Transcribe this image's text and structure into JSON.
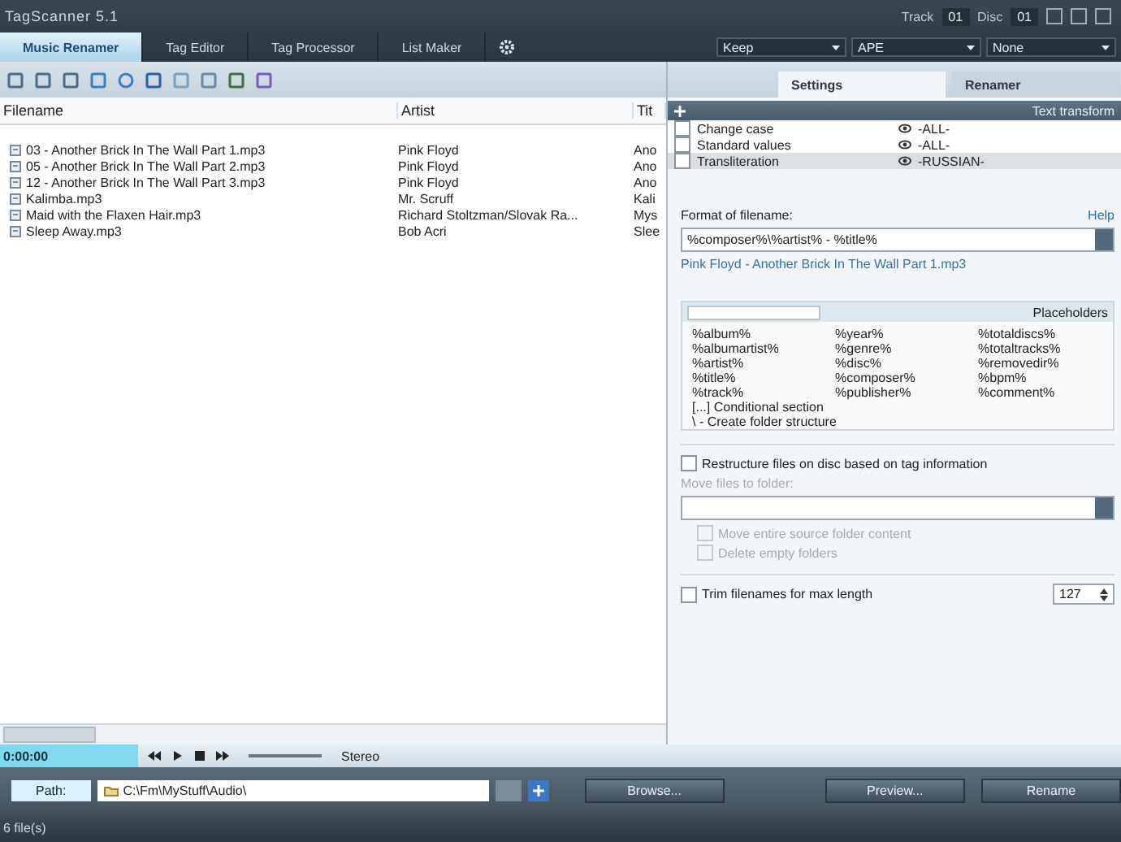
{
  "window": {
    "title": "TagScanner 5.1"
  },
  "tabs": [
    {
      "label": "Music Renamer",
      "selected": true
    },
    {
      "label": "Tag Editor",
      "selected": false
    },
    {
      "label": "Tag Processor",
      "selected": false
    },
    {
      "label": "List Maker",
      "selected": false
    }
  ],
  "top_controls": {
    "track_label": "Track",
    "track_value": "01",
    "disc_label": "Disc",
    "disc_value": "01",
    "dropdowns": [
      "Keep",
      "APE",
      "None"
    ]
  },
  "panel_tabs": [
    {
      "label": "Settings",
      "selected": true
    },
    {
      "label": "Renamer",
      "selected": false
    }
  ],
  "file_list": {
    "columns": [
      "Filename",
      "Artist",
      "Tit"
    ],
    "rows": [
      {
        "filename": "03 - Another Brick In The Wall Part 1.mp3",
        "artist": "Pink Floyd",
        "title": "Ano"
      },
      {
        "filename": "05 - Another Brick In The Wall Part 2.mp3",
        "artist": "Pink Floyd",
        "title": "Ano"
      },
      {
        "filename": "12 - Another Brick In The Wall Part 3.mp3",
        "artist": "Pink Floyd",
        "title": "Ano"
      },
      {
        "filename": "Kalimba.mp3",
        "artist": "Mr. Scruff",
        "title": "Kali"
      },
      {
        "filename": "Maid with the Flaxen Hair.mp3",
        "artist": "Richard Stoltzman/Slovak Ra...",
        "title": "Mys"
      },
      {
        "filename": "Sleep Away.mp3",
        "artist": "Bob Acri",
        "title": "Slee"
      }
    ]
  },
  "transformations": {
    "title": "Text transform",
    "rows": [
      {
        "label": "Change case",
        "value": "-ALL-",
        "checked": false,
        "selected": false
      },
      {
        "label": "Standard values",
        "value": "-ALL-",
        "checked": false,
        "selected": false
      },
      {
        "label": "Transliteration",
        "value": "-RUSSIAN-",
        "checked": false,
        "selected": true
      }
    ]
  },
  "format": {
    "label": "Format of filename:",
    "help": "Help",
    "value": "%composer%\\%artist% - %title%",
    "preview": "Pink Floyd - Another Brick In The Wall Part 1.mp3"
  },
  "placeholders": {
    "title": "Placeholders",
    "items": [
      "%album%",
      "%year%",
      "%totaldiscs%",
      "%albumartist%",
      "%genre%",
      "%totaltracks%",
      "%artist%",
      "%disc%",
      "%removedir%",
      "%title%",
      "%composer%",
      "%bpm%",
      "%track%",
      "%publisher%",
      "%comment%"
    ],
    "notes": [
      "[...] Conditional section",
      "\\ - Create folder structure"
    ]
  },
  "restructure": {
    "label": "Restructure files on disc based on tag information",
    "checked": false,
    "folder_label": "Move files to folder:",
    "options": [
      {
        "label": "Move entire source folder content",
        "checked": false,
        "disabled": true
      },
      {
        "label": "Delete empty folders",
        "checked": false,
        "disabled": true
      }
    ]
  },
  "trim": {
    "label": "Trim filenames for max length",
    "checked": false,
    "value": "127"
  },
  "player": {
    "time": "0:00:00",
    "volume": {
      "level": 1
    },
    "mode": "Stereo"
  },
  "path_bar": {
    "label": "Path:",
    "value": "C:\\Fm\\MyStuff\\Audio\\",
    "buttons": [
      "Browse...",
      "Preview...",
      "Rename"
    ]
  },
  "status_bar": {
    "text": "6 file(s)"
  }
}
